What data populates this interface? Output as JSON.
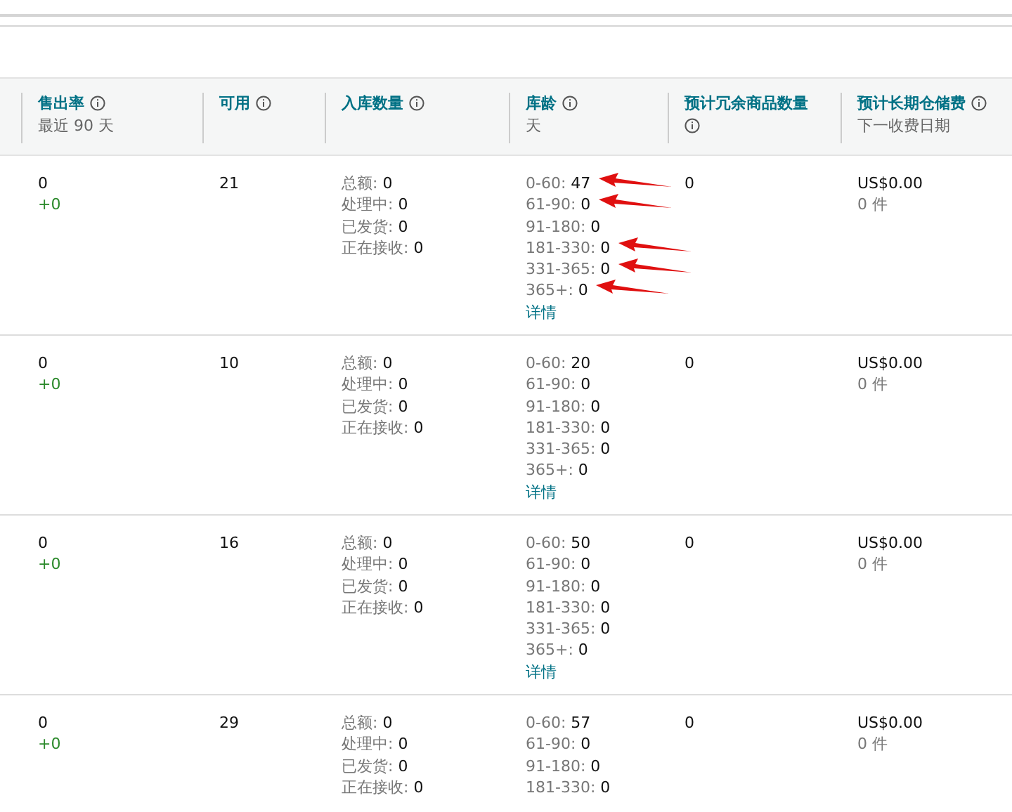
{
  "columns": [
    {
      "label": "售出率",
      "sublabel": "最近 90 天"
    },
    {
      "label": "可用"
    },
    {
      "label": "入库数量"
    },
    {
      "label": "库龄",
      "sublabel": "天"
    },
    {
      "label": "预计冗余商品数量"
    },
    {
      "label": "预计长期仓储费",
      "sublabel": "下一收费日期"
    }
  ],
  "rows": [
    {
      "sell_through": "0",
      "change": "+0",
      "available": "21",
      "inbound": [
        {
          "label": "总额:",
          "value": "0"
        },
        {
          "label": "处理中:",
          "value": "0"
        },
        {
          "label": "已发货:",
          "value": "0"
        },
        {
          "label": "正在接收:",
          "value": "0"
        }
      ],
      "age": [
        {
          "label": "0-60:",
          "value": "47",
          "arrow": true
        },
        {
          "label": "61-90:",
          "value": "0",
          "arrow": true
        },
        {
          "label": "91-180:",
          "value": "0",
          "arrow": false
        },
        {
          "label": "181-330:",
          "value": "0",
          "arrow": true
        },
        {
          "label": "331-365:",
          "value": "0",
          "arrow": true
        },
        {
          "label": "365+:",
          "value": "0",
          "arrow": true
        }
      ],
      "details": "详情",
      "excess": "0",
      "fee": "US$0.00",
      "units": "0 件"
    },
    {
      "sell_through": "0",
      "change": "+0",
      "available": "10",
      "inbound": [
        {
          "label": "总额:",
          "value": "0"
        },
        {
          "label": "处理中:",
          "value": "0"
        },
        {
          "label": "已发货:",
          "value": "0"
        },
        {
          "label": "正在接收:",
          "value": "0"
        }
      ],
      "age": [
        {
          "label": "0-60:",
          "value": "20",
          "arrow": false
        },
        {
          "label": "61-90:",
          "value": "0",
          "arrow": false
        },
        {
          "label": "91-180:",
          "value": "0",
          "arrow": false
        },
        {
          "label": "181-330:",
          "value": "0",
          "arrow": false
        },
        {
          "label": "331-365:",
          "value": "0",
          "arrow": false
        },
        {
          "label": "365+:",
          "value": "0",
          "arrow": false
        }
      ],
      "details": "详情",
      "excess": "0",
      "fee": "US$0.00",
      "units": "0 件"
    },
    {
      "sell_through": "0",
      "change": "+0",
      "available": "16",
      "inbound": [
        {
          "label": "总额:",
          "value": "0"
        },
        {
          "label": "处理中:",
          "value": "0"
        },
        {
          "label": "已发货:",
          "value": "0"
        },
        {
          "label": "正在接收:",
          "value": "0"
        }
      ],
      "age": [
        {
          "label": "0-60:",
          "value": "50",
          "arrow": false
        },
        {
          "label": "61-90:",
          "value": "0",
          "arrow": false
        },
        {
          "label": "91-180:",
          "value": "0",
          "arrow": false
        },
        {
          "label": "181-330:",
          "value": "0",
          "arrow": false
        },
        {
          "label": "331-365:",
          "value": "0",
          "arrow": false
        },
        {
          "label": "365+:",
          "value": "0",
          "arrow": false
        }
      ],
      "details": "详情",
      "excess": "0",
      "fee": "US$0.00",
      "units": "0 件"
    },
    {
      "sell_through": "0",
      "change": "+0",
      "available": "29",
      "inbound": [
        {
          "label": "总额:",
          "value": "0"
        },
        {
          "label": "处理中:",
          "value": "0"
        },
        {
          "label": "已发货:",
          "value": "0"
        },
        {
          "label": "正在接收:",
          "value": "0"
        }
      ],
      "age": [
        {
          "label": "0-60:",
          "value": "57",
          "arrow": false
        },
        {
          "label": "61-90:",
          "value": "0",
          "arrow": false
        },
        {
          "label": "91-180:",
          "value": "0",
          "arrow": false
        },
        {
          "label": "181-330:",
          "value": "0",
          "arrow": false
        }
      ],
      "excess": "0",
      "fee": "US$0.00",
      "units": "0 件"
    }
  ]
}
